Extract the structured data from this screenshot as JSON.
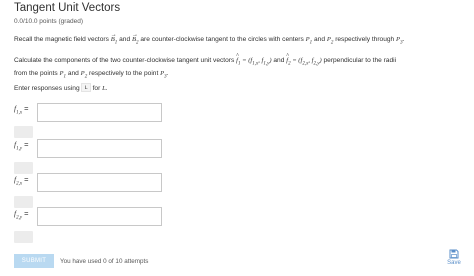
{
  "problem": {
    "title": "Tangent Unit Vectors",
    "points": "0.0/10.0 points (graded)"
  },
  "paragraph1": {
    "t1": "Recall the magnetic field vectors ",
    "t2": " and ",
    "t3": " are counter-clockwise tangent to the circles with centers ",
    "t4": " and ",
    "t5": " respectively through ",
    "t6": "."
  },
  "paragraph2": {
    "t1": "Calculate the components of the two counter-clockwise tangent unit vectors ",
    "t2": " and ",
    "t3": " perpendicular to the radii",
    "t4": "from the points ",
    "t5": " and ",
    "t6": " respectively to the point ",
    "t7": "."
  },
  "paragraph3": {
    "t1": "Enter responses using ",
    "code": "L",
    "t2": " for ",
    "t3": "."
  },
  "math": {
    "B1": "B",
    "B2": "B",
    "sub1": "1",
    "sub2": "2",
    "sub3": "3",
    "P": "P",
    "f": "f",
    "L": "L",
    "f1_def": " = (f",
    "f1_def_sub_x": "1,x",
    "f1_def_mid": ", f",
    "f1_def_sub_y": "1,y",
    "f1_def_end": ")",
    "f2_def": " = (f",
    "f2_def_sub_x": "2,x",
    "f2_def_mid": ", f",
    "f2_def_sub_y": "2,y",
    "f2_def_end": ")"
  },
  "fields": [
    {
      "label": "f",
      "sub": "1,x",
      "eq": " ="
    },
    {
      "label": "f",
      "sub": "1,y",
      "eq": " ="
    },
    {
      "label": "f",
      "sub": "2,x",
      "eq": " ="
    },
    {
      "label": "f",
      "sub": "2,y",
      "eq": " ="
    }
  ],
  "actions": {
    "submit_label": "SUBMIT",
    "attempts_text": "You have used 0 of 10 attempts",
    "save_label": "Save"
  },
  "colors": {
    "submit_bg": "#b9d9f1",
    "save_accent": "#5b8fc9"
  }
}
